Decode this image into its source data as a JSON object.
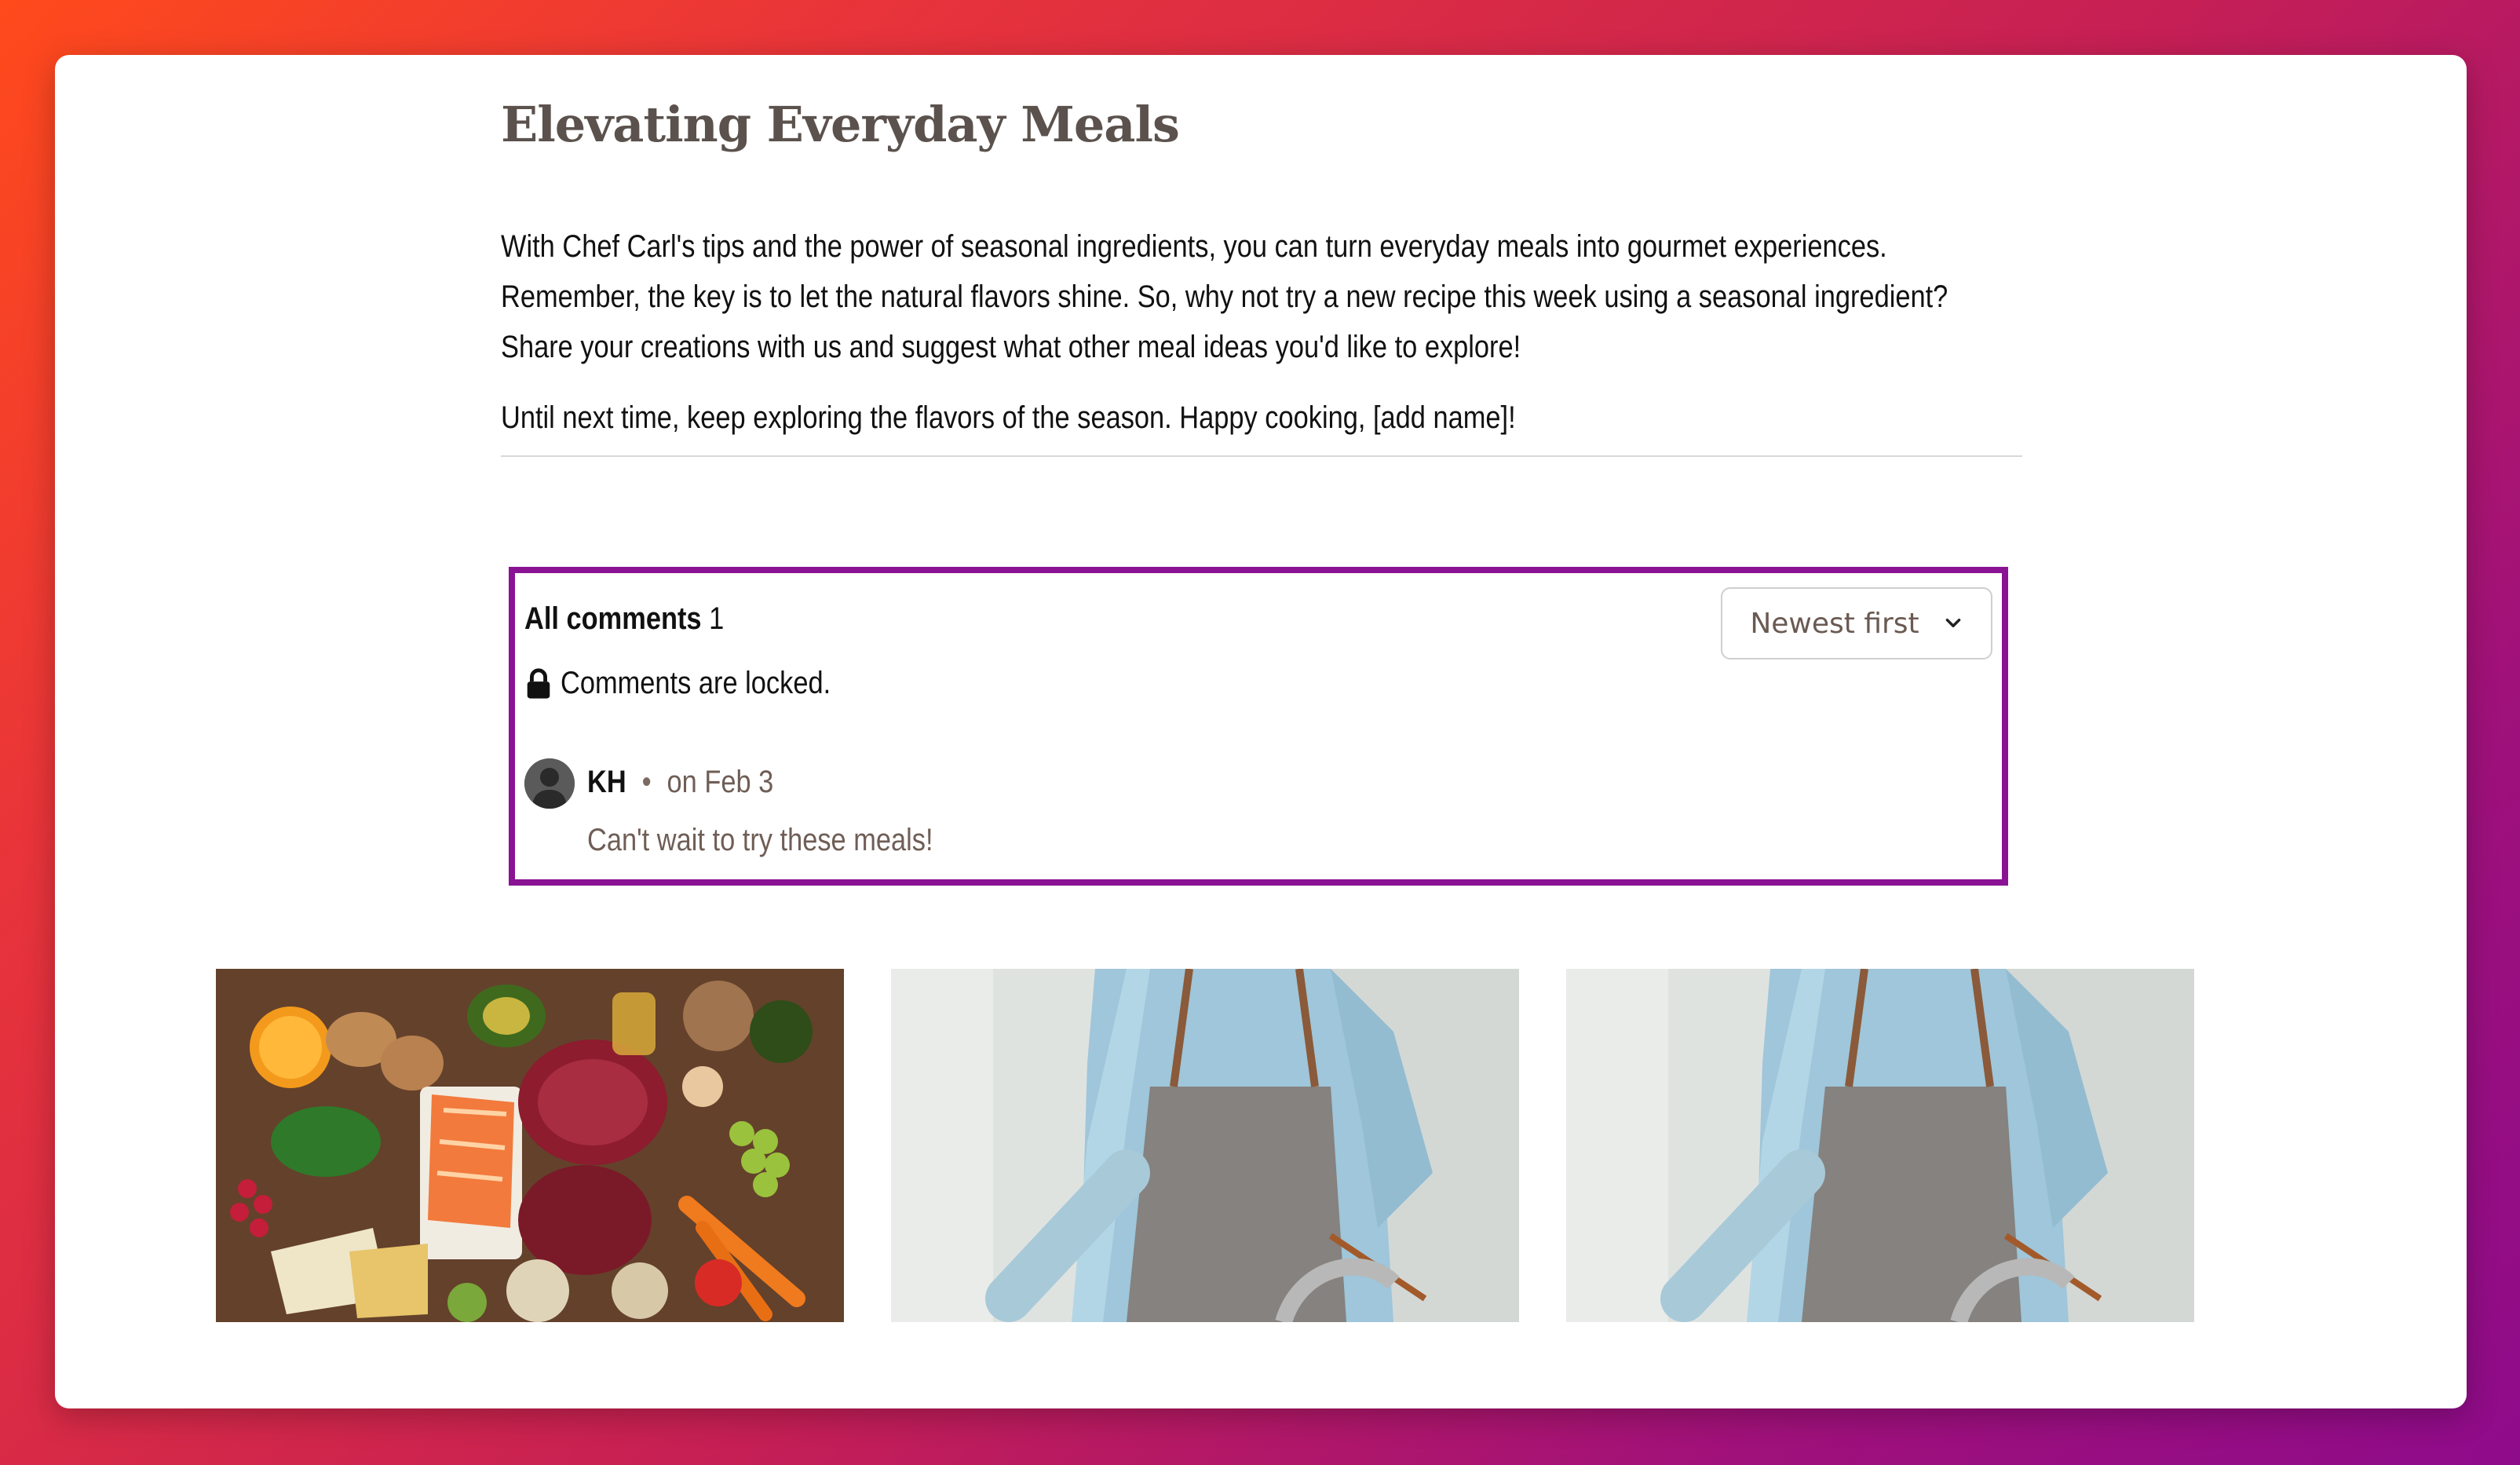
{
  "article": {
    "clipped_line": "...",
    "heading": "Elevating Everyday Meals",
    "paragraph1": "With Chef Carl's tips and the power of seasonal ingredients, you can turn everyday meals into gourmet experiences. Remember, the key is to let the natural flavors shine. So, why not try a new recipe this week using a seasonal ingredient? Share your creations with us and suggest what other meal ideas you'd like to explore!",
    "paragraph2": "Until next time, keep exploring the flavors of the season. Happy cooking, [add name]!"
  },
  "comments": {
    "title": "All comments",
    "count": "1",
    "locked_text": "Comments are locked.",
    "sort_label": "Newest first",
    "items": [
      {
        "author": "KH",
        "separator": "•",
        "date": "on Feb 3",
        "body": "Can't wait to try these meals!"
      }
    ]
  },
  "related_posts": [
    {
      "image": "food-ingredients-photo",
      "title": ""
    },
    {
      "image": "chef-apron-photo",
      "title": ""
    },
    {
      "image": "chef-apron-photo",
      "title": ""
    }
  ]
}
